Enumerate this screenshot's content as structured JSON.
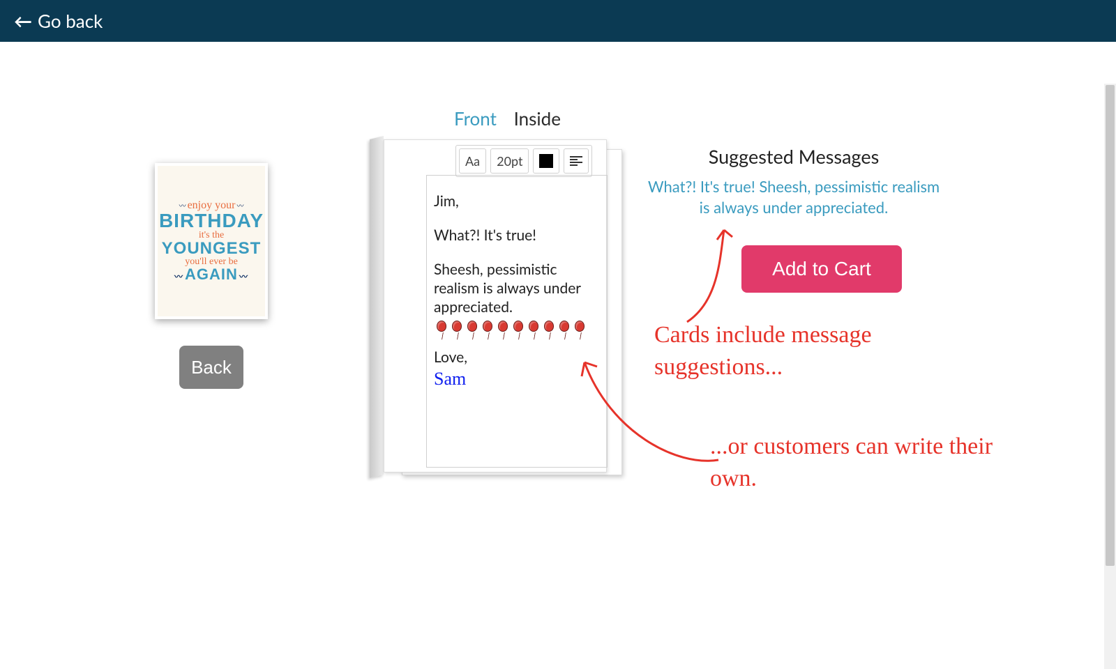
{
  "header": {
    "go_back_label": "Go back"
  },
  "tabs": {
    "front": "Front",
    "inside": "Inside",
    "active": "Inside"
  },
  "thumbnail": {
    "line_enjoy": "enjoy your",
    "line_birthday": "BIRTHDAY",
    "line_its": "it's the",
    "line_youngest": "YOUNGEST",
    "line_youll": "you'll ever be",
    "line_again": "AGAIN"
  },
  "thumb_button": "Back",
  "toolbar": {
    "font_label": "Aa",
    "size_label": "20pt",
    "color_hex": "#000000",
    "align_icon": "align-left-icon"
  },
  "editor": {
    "greeting": "Jim,",
    "p1": "What?! It's true!",
    "p2": "Sheesh, pessimistic realism is always under appreciated.",
    "balloon_emoji": "🎈",
    "balloon_count": 10,
    "signoff": "Love,",
    "signature": "Sam"
  },
  "right": {
    "suggested_title": "Suggested Messages",
    "suggested_text": "What?! It's true! Sheesh, pessimistic realism is always under appreciated.",
    "add_to_cart": "Add to Cart"
  },
  "annotations": {
    "a1": "Cards include message suggestions...",
    "a2": "...or customers can write their own."
  },
  "colors": {
    "header_bg": "#0b3a53",
    "accent_link": "#3a9bbf",
    "cta_bg": "#e13a6a",
    "annotation": "#e6332a"
  }
}
